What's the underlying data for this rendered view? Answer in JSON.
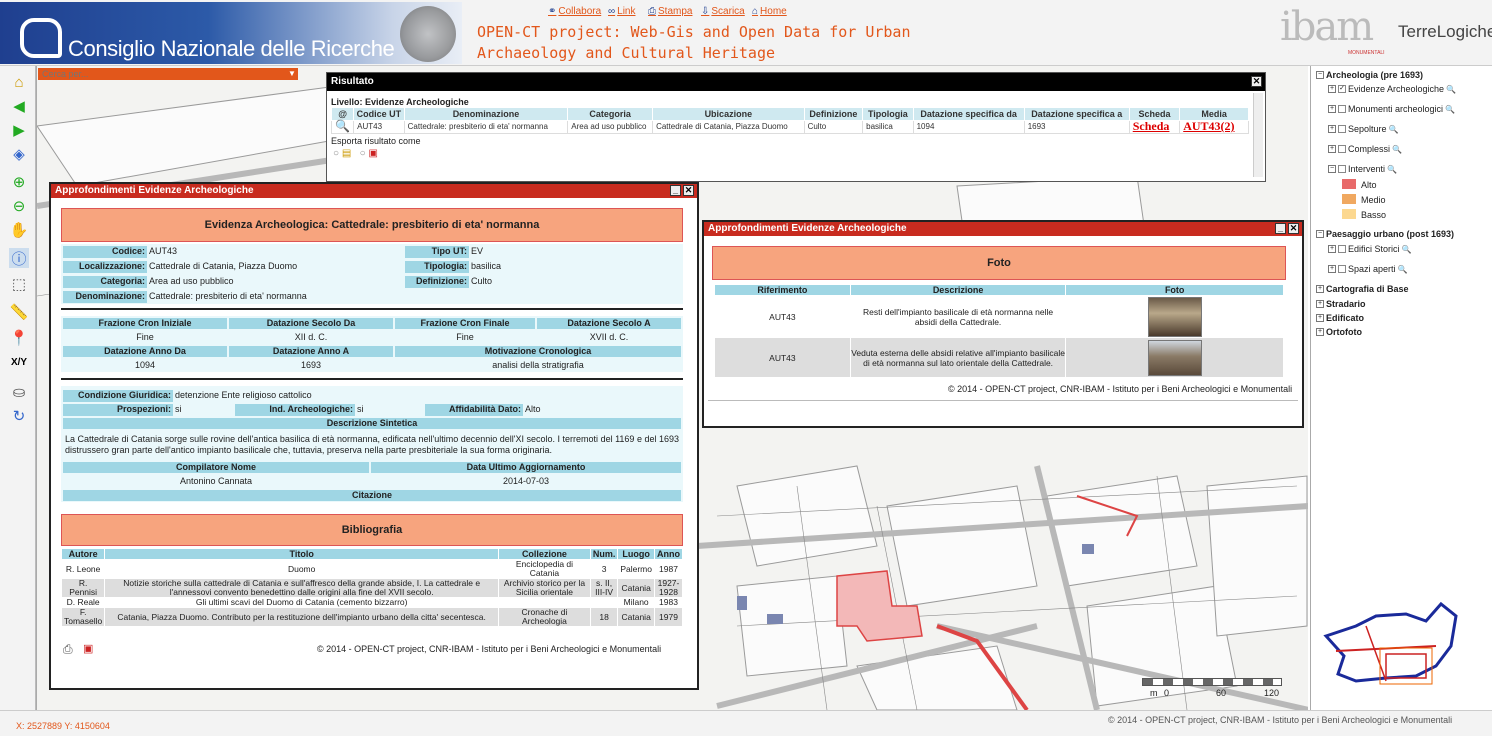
{
  "header": {
    "cnr_title": "Consiglio Nazionale delle Ricerche",
    "links": [
      {
        "label": "Collabora",
        "icon": "handshake-icon"
      },
      {
        "label": "Link",
        "icon": "link-icon"
      },
      {
        "label": "Stampa",
        "icon": "print-icon"
      },
      {
        "label": "Scarica",
        "icon": "download-icon"
      },
      {
        "label": "Home",
        "icon": "home-icon"
      }
    ],
    "project_title": "OPEN-CT project: Web-Gis and Open Data for Urban Archaeology and Cultural Heritage",
    "ibam_logo": "ibam",
    "ibam_sub": "MONUMENTALI",
    "terre_logo": "TerreLogiche"
  },
  "search": {
    "placeholder": "Cerca per..."
  },
  "risultato": {
    "title": "Risultato",
    "livello": "Livello: Evidenze Archeologiche",
    "columns": [
      "@",
      "Codice UT",
      "Denominazione",
      "Categoria",
      "Ubicazione",
      "Definizione",
      "Tipologia",
      "Datazione specifica da",
      "Datazione specifica a",
      "Scheda",
      "Media"
    ],
    "row": {
      "codice": "AUT43",
      "denominazione": "Cattedrale: presbiterio di eta' normanna",
      "categoria": "Area ad uso pubblico",
      "ubicazione": "Cattedrale di Catania, Piazza Duomo",
      "definizione": "Culto",
      "tipologia": "basilica",
      "da": "1094",
      "a": "1693",
      "scheda": "Scheda",
      "media": "AUT43(2)"
    },
    "export_label": "Esporta risultato come"
  },
  "ap1": {
    "title": "Approfondimenti Evidenze Archeologiche",
    "banner": "Evidenza Archeologica: Cattedrale: presbiterio di eta' normanna",
    "fields": {
      "codice_l": "Codice:",
      "codice": "AUT43",
      "tipout_l": "Tipo UT:",
      "tipout": "EV",
      "loc_l": "Localizzazione:",
      "loc": "Cattedrale di Catania, Piazza Duomo",
      "tipol_l": "Tipologia:",
      "tipol": "basilica",
      "cat_l": "Categoria:",
      "cat": "Area ad uso pubblico",
      "def_l": "Definizione:",
      "def": "Culto",
      "den_l": "Denominazione:",
      "den": "Cattedrale: presbiterio di eta' normanna"
    },
    "cron": {
      "h1": "Frazione Cron Iniziale",
      "h2": "Datazione Secolo Da",
      "h3": "Frazione Cron Finale",
      "h4": "Datazione Secolo A",
      "v1": "Fine",
      "v2": "XII d. C.",
      "v3": "Fine",
      "v4": "XVII d. C.",
      "h5": "Datazione Anno Da",
      "h6": "Datazione Anno A",
      "h7": "Motivazione Cronologica",
      "v5": "1094",
      "v6": "1693",
      "v7": "analisi della stratigrafia"
    },
    "cond": {
      "cg_l": "Condizione Giuridica:",
      "cg": "detenzione Ente religioso cattolico",
      "pr_l": "Prospezioni:",
      "pr": "si",
      "ind_l": "Ind. Archeologiche:",
      "ind": "si",
      "aff_l": "Affidabilità Dato:",
      "aff": "Alto",
      "desc_h": "Descrizione Sintetica",
      "desc": "La Cattedrale di Catania sorge sulle rovine dell'antica basilica di età normanna, edificata nell'ultimo decennio dell'XI secolo. I terremoti del 1169 e del 1693 distrussero gran parte dell'antico impianto basilicale che, tuttavia, preserva nella parte presbiteriale la sua forma originaria.",
      "comp_h": "Compilatore Nome",
      "agg_h": "Data Ultimo Aggiornamento",
      "comp": "Antonino Cannata",
      "agg": "2014-07-03",
      "cit_h": "Citazione"
    },
    "biblio_banner": "Bibliografia",
    "biblio_cols": [
      "Autore",
      "Titolo",
      "Collezione",
      "Num.",
      "Luogo",
      "Anno"
    ],
    "biblio": [
      {
        "autore": "R. Leone",
        "titolo": "Duomo",
        "coll": "Enciclopedia di Catania",
        "num": "3",
        "luogo": "Palermo",
        "anno": "1987"
      },
      {
        "autore": "R. Pennisi",
        "titolo": "Notizie storiche sulla cattedrale di Catania e sull'affresco della grande abside, I. La cattedrale e l'annessovi convento benedettino dalle origini alla fine del XVII secolo.",
        "coll": "Archivio storico per la Sicilia orientale",
        "num": "s. II, III-IV",
        "luogo": "Catania",
        "anno": "1927-1928"
      },
      {
        "autore": "D. Reale",
        "titolo": "Gli ultimi scavi del Duomo di Catania (cemento bizzarro)",
        "coll": "",
        "num": "",
        "luogo": "Milano",
        "anno": "1983"
      },
      {
        "autore": "F. Tomasello",
        "titolo": "Catania, Piazza Duomo. Contributo per la restituzione dell'impianto urbano della citta' secentesca.",
        "coll": "Cronache di Archeologia",
        "num": "18",
        "luogo": "Catania",
        "anno": "1979"
      }
    ],
    "footer": "© 2014 - OPEN-CT project, CNR-IBAM - Istituto per i Beni Archeologici e Monumentali"
  },
  "ap2": {
    "title": "Approfondimenti Evidenze Archeologiche",
    "banner": "Foto",
    "cols": [
      "Riferimento",
      "Descrizione",
      "Foto"
    ],
    "rows": [
      {
        "rif": "AUT43",
        "desc": "Resti dell'impianto basilicale di età normanna nelle absidi della Cattedrale."
      },
      {
        "rif": "AUT43",
        "desc": "Veduta esterna delle absidi relative all'impianto basilicale di età normanna sul lato orientale della Cattedrale."
      }
    ],
    "footer": "© 2014 - OPEN-CT project, CNR-IBAM - Istituto per i Beni Archeologici e Monumentali"
  },
  "layers": {
    "arch": "Archeologia (pre 1693)",
    "evid": "Evidenze Archeologiche",
    "mon": "Monumenti archeologici",
    "sep": "Sepolture",
    "comp": "Complessi",
    "int": "Interventi",
    "alto": "Alto",
    "medio": "Medio",
    "basso": "Basso",
    "pae": "Paesaggio urbano (post 1693)",
    "edif": "Edifici Storici",
    "spazi": "Spazi aperti",
    "cart": "Cartografia di Base",
    "strad": "Stradario",
    "edific": "Edificato",
    "orto": "Ortofoto",
    "colors": {
      "alto": "#e86a6a",
      "medio": "#f0a860",
      "basso": "#fcd890"
    }
  },
  "scale": {
    "s0": "m",
    "s1": "0",
    "s2": "60",
    "s3": "120"
  },
  "footer": {
    "coords": "X: 2527889   Y: 4150604",
    "copyright": "© 2014 - OPEN-CT project, CNR-IBAM - Istituto per i Beni Archeologici e Monumentali"
  }
}
